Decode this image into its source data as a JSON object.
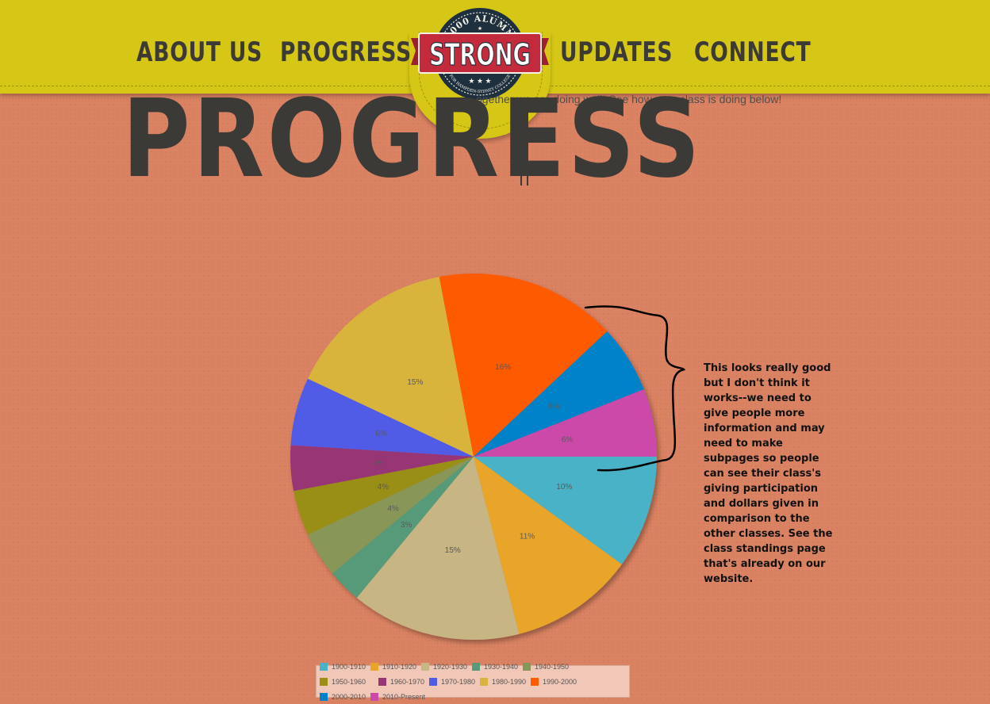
{
  "nav": {
    "about": "ABOUT US",
    "progress": "PROGRESS",
    "updates": "UPDATES",
    "connect": "CONNECT"
  },
  "logo": {
    "top_text": "3,000 ALUMNI",
    "main_text": "STRONG",
    "bottom_text": "FOR HAMPDEN-SYDNEY COLLEGE"
  },
  "page": {
    "title": "PROGRESS",
    "subtitle": "ogether we are doing well! See how your class is doing below!"
  },
  "annotation": "This looks really good but I don't think it works--we need to give people more information and may need to make subpages so people can see their class's giving participation and dollars given in comparison to the other classes. See the class standings page that's already on our website.",
  "colors": {
    "header": "#d6c615",
    "background": "#d98160",
    "text_dark": "#3b3a36",
    "logo_red": "#c32a3c",
    "logo_navy": "#1e2f3d"
  },
  "chart_data": {
    "type": "pie",
    "legend_position": "bottom",
    "slices": [
      {
        "label": "1900-1910",
        "value": 10,
        "color": "#4ab2c6"
      },
      {
        "label": "1910-1920",
        "value": 11,
        "color": "#e9a52a"
      },
      {
        "label": "1920-1930",
        "value": 15,
        "color": "#c7b583"
      },
      {
        "label": "1930-1940",
        "value": 3,
        "color": "#569a7a"
      },
      {
        "label": "1940-1950",
        "value": 4,
        "color": "#889759"
      },
      {
        "label": "1950-1960",
        "value": 4,
        "color": "#9a8f12"
      },
      {
        "label": "1960-1970",
        "value": 4,
        "color": "#983574"
      },
      {
        "label": "1970-1980",
        "value": 6,
        "color": "#515be6"
      },
      {
        "label": "1980-1990",
        "value": 15,
        "color": "#d9b43d"
      },
      {
        "label": "1990-2000",
        "value": 16,
        "color": "#fe5a01"
      },
      {
        "label": "2000-2010",
        "value": 6,
        "color": "#0082c9"
      },
      {
        "label": "2010-Present",
        "value": 6,
        "color": "#cb49a8"
      }
    ]
  }
}
